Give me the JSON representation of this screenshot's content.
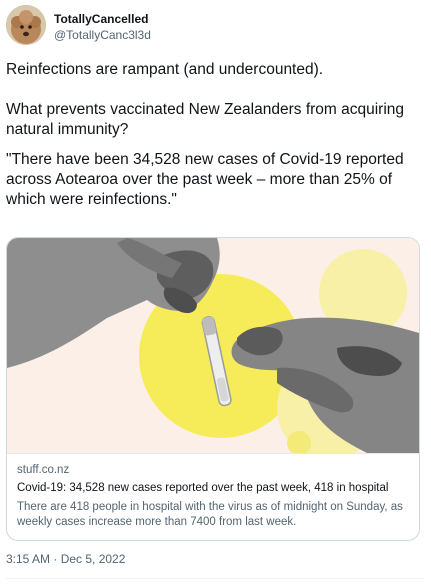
{
  "author": {
    "display_name": "TotallyCancelled",
    "handle": "@TotallyCanc3l3d",
    "avatar_icon": "poodle-dog-avatar"
  },
  "tweet": {
    "paragraphs": [
      "Reinfections are rampant (and undercounted).",
      "What prevents vaccinated New Zealanders from acquiring natural immunity?",
      "\"There have been 34,528 new cases of Covid-19 reported across Aotearoa over the past week – more than 25% of which were reinfections.\""
    ],
    "timestamp": "3:15 AM · Dec 5, 2022"
  },
  "link_card": {
    "image_icon": "hands-holding-test-vial-image",
    "domain": "stuff.co.nz",
    "title": "Covid-19: 34,528 new cases reported over the past week, 418 in hospital",
    "description": "There are 418 people in hospital with the virus as of midnight on Sunday, as weekly cases increase more than 7400 from last week."
  },
  "colors": {
    "text": "#0f1419",
    "secondary_text": "#536471",
    "border": "#cfd9de",
    "image_background": "#fcefe8",
    "image_yellow": "#f6ec5a"
  }
}
